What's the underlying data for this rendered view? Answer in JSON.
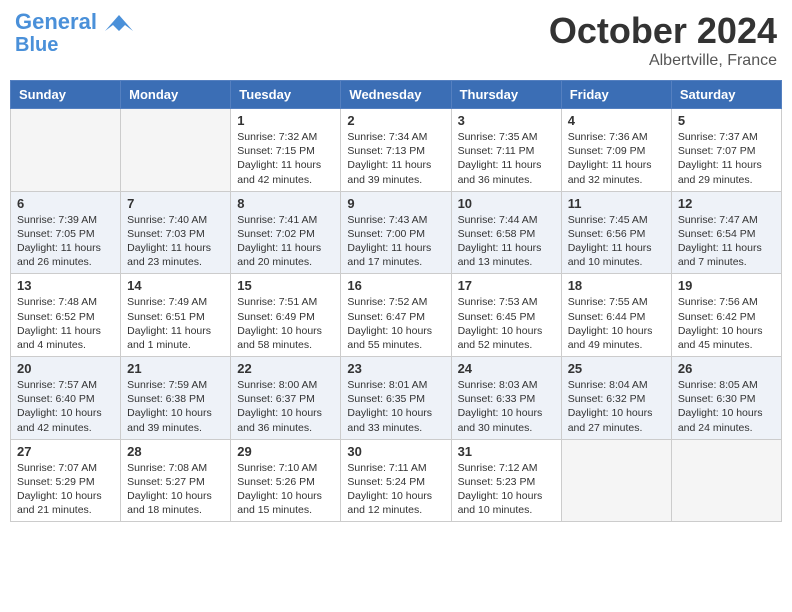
{
  "header": {
    "logo_line1": "General",
    "logo_line2": "Blue",
    "month": "October 2024",
    "location": "Albertville, France"
  },
  "weekdays": [
    "Sunday",
    "Monday",
    "Tuesday",
    "Wednesday",
    "Thursday",
    "Friday",
    "Saturday"
  ],
  "weeks": [
    [
      {
        "day": "",
        "empty": true
      },
      {
        "day": "",
        "empty": true
      },
      {
        "day": "1",
        "sunrise": "7:32 AM",
        "sunset": "7:15 PM",
        "daylight": "11 hours and 42 minutes."
      },
      {
        "day": "2",
        "sunrise": "7:34 AM",
        "sunset": "7:13 PM",
        "daylight": "11 hours and 39 minutes."
      },
      {
        "day": "3",
        "sunrise": "7:35 AM",
        "sunset": "7:11 PM",
        "daylight": "11 hours and 36 minutes."
      },
      {
        "day": "4",
        "sunrise": "7:36 AM",
        "sunset": "7:09 PM",
        "daylight": "11 hours and 32 minutes."
      },
      {
        "day": "5",
        "sunrise": "7:37 AM",
        "sunset": "7:07 PM",
        "daylight": "11 hours and 29 minutes."
      }
    ],
    [
      {
        "day": "6",
        "sunrise": "7:39 AM",
        "sunset": "7:05 PM",
        "daylight": "11 hours and 26 minutes."
      },
      {
        "day": "7",
        "sunrise": "7:40 AM",
        "sunset": "7:03 PM",
        "daylight": "11 hours and 23 minutes."
      },
      {
        "day": "8",
        "sunrise": "7:41 AM",
        "sunset": "7:02 PM",
        "daylight": "11 hours and 20 minutes."
      },
      {
        "day": "9",
        "sunrise": "7:43 AM",
        "sunset": "7:00 PM",
        "daylight": "11 hours and 17 minutes."
      },
      {
        "day": "10",
        "sunrise": "7:44 AM",
        "sunset": "6:58 PM",
        "daylight": "11 hours and 13 minutes."
      },
      {
        "day": "11",
        "sunrise": "7:45 AM",
        "sunset": "6:56 PM",
        "daylight": "11 hours and 10 minutes."
      },
      {
        "day": "12",
        "sunrise": "7:47 AM",
        "sunset": "6:54 PM",
        "daylight": "11 hours and 7 minutes."
      }
    ],
    [
      {
        "day": "13",
        "sunrise": "7:48 AM",
        "sunset": "6:52 PM",
        "daylight": "11 hours and 4 minutes."
      },
      {
        "day": "14",
        "sunrise": "7:49 AM",
        "sunset": "6:51 PM",
        "daylight": "11 hours and 1 minute."
      },
      {
        "day": "15",
        "sunrise": "7:51 AM",
        "sunset": "6:49 PM",
        "daylight": "10 hours and 58 minutes."
      },
      {
        "day": "16",
        "sunrise": "7:52 AM",
        "sunset": "6:47 PM",
        "daylight": "10 hours and 55 minutes."
      },
      {
        "day": "17",
        "sunrise": "7:53 AM",
        "sunset": "6:45 PM",
        "daylight": "10 hours and 52 minutes."
      },
      {
        "day": "18",
        "sunrise": "7:55 AM",
        "sunset": "6:44 PM",
        "daylight": "10 hours and 49 minutes."
      },
      {
        "day": "19",
        "sunrise": "7:56 AM",
        "sunset": "6:42 PM",
        "daylight": "10 hours and 45 minutes."
      }
    ],
    [
      {
        "day": "20",
        "sunrise": "7:57 AM",
        "sunset": "6:40 PM",
        "daylight": "10 hours and 42 minutes."
      },
      {
        "day": "21",
        "sunrise": "7:59 AM",
        "sunset": "6:38 PM",
        "daylight": "10 hours and 39 minutes."
      },
      {
        "day": "22",
        "sunrise": "8:00 AM",
        "sunset": "6:37 PM",
        "daylight": "10 hours and 36 minutes."
      },
      {
        "day": "23",
        "sunrise": "8:01 AM",
        "sunset": "6:35 PM",
        "daylight": "10 hours and 33 minutes."
      },
      {
        "day": "24",
        "sunrise": "8:03 AM",
        "sunset": "6:33 PM",
        "daylight": "10 hours and 30 minutes."
      },
      {
        "day": "25",
        "sunrise": "8:04 AM",
        "sunset": "6:32 PM",
        "daylight": "10 hours and 27 minutes."
      },
      {
        "day": "26",
        "sunrise": "8:05 AM",
        "sunset": "6:30 PM",
        "daylight": "10 hours and 24 minutes."
      }
    ],
    [
      {
        "day": "27",
        "sunrise": "7:07 AM",
        "sunset": "5:29 PM",
        "daylight": "10 hours and 21 minutes."
      },
      {
        "day": "28",
        "sunrise": "7:08 AM",
        "sunset": "5:27 PM",
        "daylight": "10 hours and 18 minutes."
      },
      {
        "day": "29",
        "sunrise": "7:10 AM",
        "sunset": "5:26 PM",
        "daylight": "10 hours and 15 minutes."
      },
      {
        "day": "30",
        "sunrise": "7:11 AM",
        "sunset": "5:24 PM",
        "daylight": "10 hours and 12 minutes."
      },
      {
        "day": "31",
        "sunrise": "7:12 AM",
        "sunset": "5:23 PM",
        "daylight": "10 hours and 10 minutes."
      },
      {
        "day": "",
        "empty": true
      },
      {
        "day": "",
        "empty": true
      }
    ]
  ]
}
